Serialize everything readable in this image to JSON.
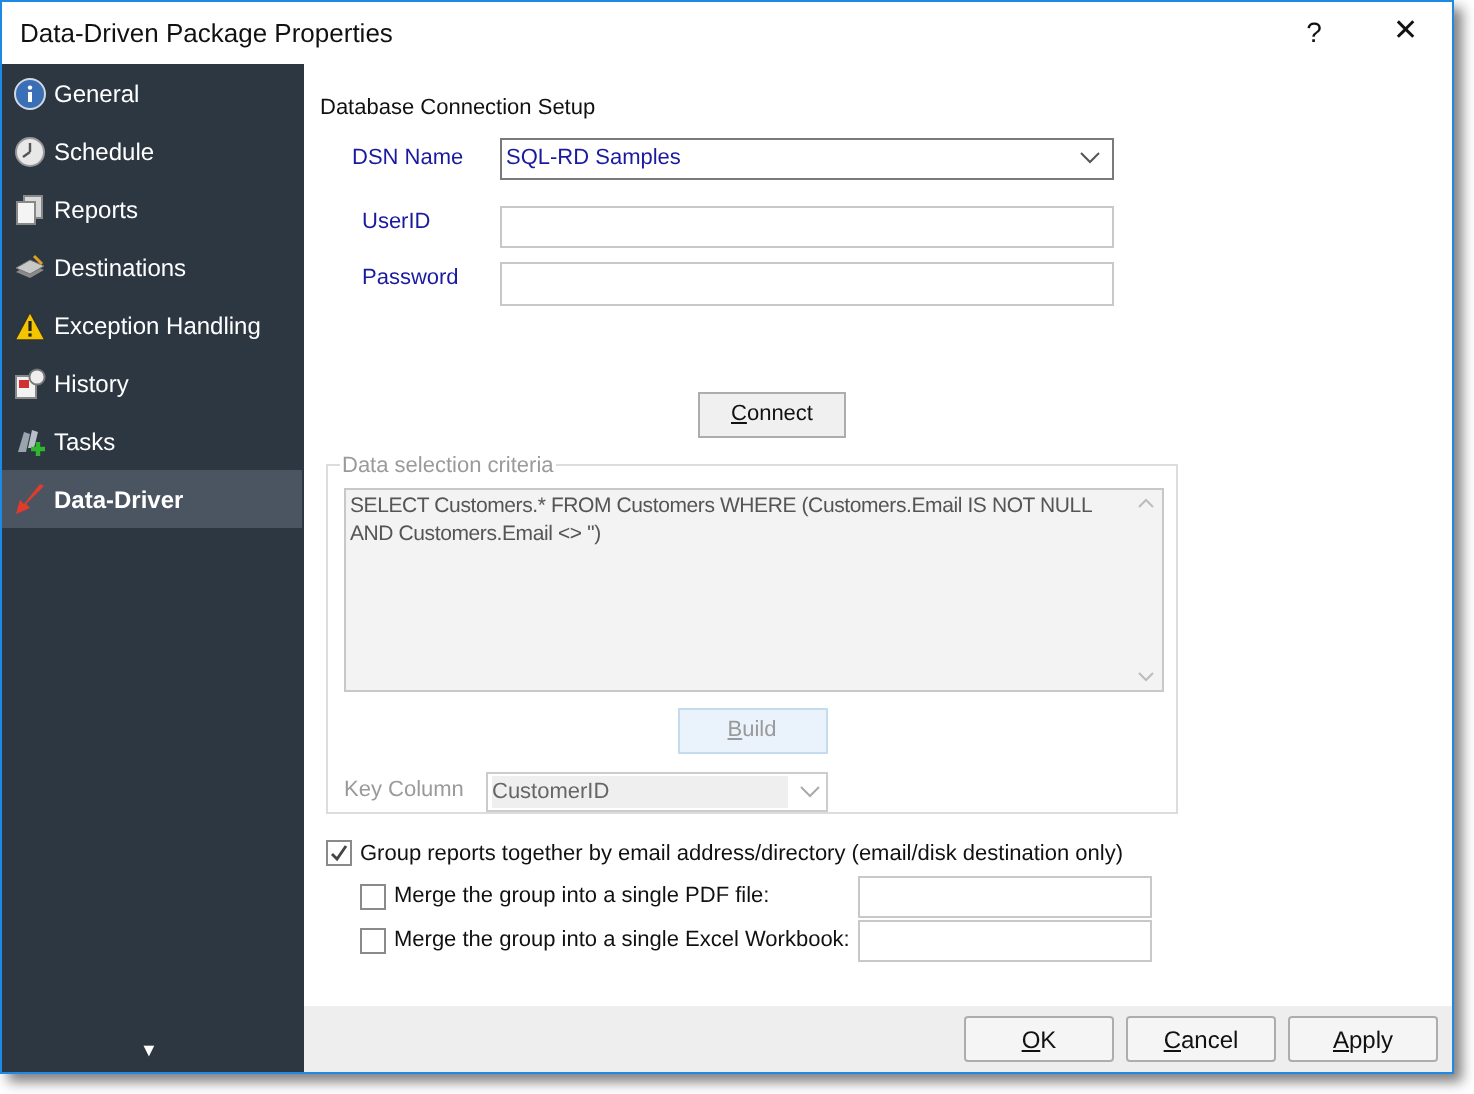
{
  "window": {
    "title": "Data-Driven Package Properties",
    "help": "?",
    "close": "✕"
  },
  "sidebar": {
    "items": [
      {
        "label": "General",
        "kind": "info",
        "selected": false
      },
      {
        "label": "Schedule",
        "kind": "clock",
        "selected": false
      },
      {
        "label": "Reports",
        "kind": "pages",
        "selected": false
      },
      {
        "label": "Destinations",
        "kind": "stack",
        "selected": false
      },
      {
        "label": "Exception Handling",
        "kind": "warning",
        "selected": false
      },
      {
        "label": "History",
        "kind": "history",
        "selected": false
      },
      {
        "label": "Tasks",
        "kind": "tasks",
        "selected": false
      },
      {
        "label": "Data-Driver",
        "kind": "driver",
        "selected": true
      }
    ],
    "more": "▼"
  },
  "connection": {
    "heading": "Database Connection Setup",
    "dsn_label": "DSN Name",
    "dsn_value": "SQL-RD Samples",
    "userid_label": "UserID",
    "password_label": "Password",
    "connect": "Connect"
  },
  "criteria": {
    "legend": "Data selection criteria",
    "disabled": true,
    "query": "SELECT Customers.* FROM Customers WHERE (Customers.Email IS NOT NULL AND Customers.Email <> '')",
    "build": "Build",
    "key_label": "Key Column",
    "key_value": "CustomerID"
  },
  "options": [
    {
      "label": "Group reports together by email address/directory (email/disk destination only)",
      "checked": true,
      "field": false
    },
    {
      "label": "Merge the group into a single PDF file:",
      "checked": false,
      "field": true
    },
    {
      "label": "Merge the group into a single Excel Workbook:",
      "checked": false,
      "field": true
    }
  ],
  "buttons": [
    "OK",
    "Cancel",
    "Apply"
  ]
}
